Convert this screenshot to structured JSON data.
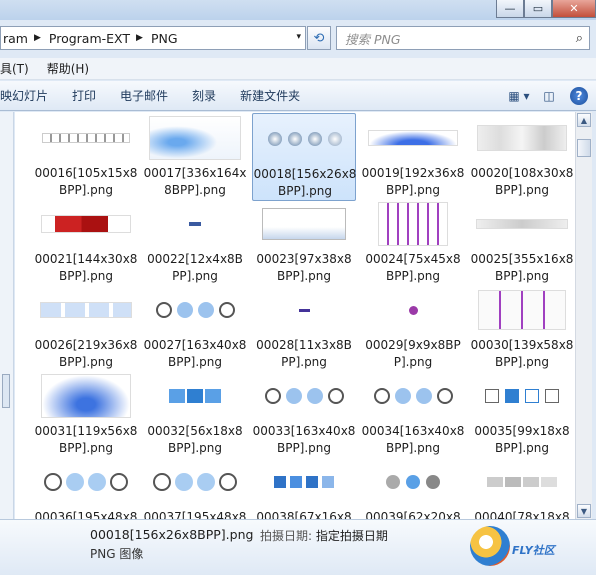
{
  "address": {
    "crumbs": [
      "ram",
      "Program-EXT",
      "PNG"
    ],
    "sep": "▶",
    "dropdown": "▾"
  },
  "search": {
    "placeholder": "搜索 PNG"
  },
  "menu": {
    "items": [
      "具(T)",
      "帮助(H)"
    ]
  },
  "toolbar": {
    "items": [
      "映幻灯片",
      "打印",
      "电子邮件",
      "刻录",
      "新建文件夹"
    ]
  },
  "files": [
    {
      "name": "00016[105x15x8BPP].png",
      "line1": "00016[105x15x8",
      "line2": "BPP].png"
    },
    {
      "name": "00017[336x164x8BPP].png",
      "line1": "00017[336x164x",
      "line2": "8BPP].png"
    },
    {
      "name": "00018[156x26x8BPP].png",
      "line1": "00018[156x26x8",
      "line2": "BPP].png",
      "selected": true
    },
    {
      "name": "00019[192x36x8BPP].png",
      "line1": "00019[192x36x8",
      "line2": "BPP].png"
    },
    {
      "name": "00020[108x30x8BPP].png",
      "line1": "00020[108x30x8",
      "line2": "BPP].png"
    },
    {
      "name": "00021[144x30x8BPP].png",
      "line1": "00021[144x30x8",
      "line2": "BPP].png"
    },
    {
      "name": "00022[12x4x8BPP].png",
      "line1": "00022[12x4x8B",
      "line2": "PP].png"
    },
    {
      "name": "00023[97x38x8BPP].png",
      "line1": "00023[97x38x8",
      "line2": "BPP].png"
    },
    {
      "name": "00024[75x45x8BPP].png",
      "line1": "00024[75x45x8",
      "line2": "BPP].png"
    },
    {
      "name": "00025[355x16x8BPP].png",
      "line1": "00025[355x16x8",
      "line2": "BPP].png"
    },
    {
      "name": "00026[219x36x8BPP].png",
      "line1": "00026[219x36x8",
      "line2": "BPP].png"
    },
    {
      "name": "00027[163x40x8BPP].png",
      "line1": "00027[163x40x8",
      "line2": "BPP].png"
    },
    {
      "name": "00028[11x3x8BPP].png",
      "line1": "00028[11x3x8B",
      "line2": "PP].png"
    },
    {
      "name": "00029[9x9x8BPP].png",
      "line1": "00029[9x9x8BP",
      "line2": "P].png"
    },
    {
      "name": "00030[139x58x8BPP].png",
      "line1": "00030[139x58x8",
      "line2": "BPP].png"
    },
    {
      "name": "00031[119x56x8BPP].png",
      "line1": "00031[119x56x8",
      "line2": "BPP].png"
    },
    {
      "name": "00032[56x18x8BPP].png",
      "line1": "00032[56x18x8",
      "line2": "BPP].png"
    },
    {
      "name": "00033[163x40x8BPP].png",
      "line1": "00033[163x40x8",
      "line2": "BPP].png"
    },
    {
      "name": "00034[163x40x8BPP].png",
      "line1": "00034[163x40x8",
      "line2": "BPP].png"
    },
    {
      "name": "00035[99x18x8BPP].png",
      "line1": "00035[99x18x8",
      "line2": "BPP].png"
    },
    {
      "name": "00036[195x48x8BPP].png",
      "line1": "00036[195x48x8",
      "line2": "BPP].png"
    },
    {
      "name": "00037[195x48x8BPP].png",
      "line1": "00037[195x48x8",
      "line2": "BPP].png"
    },
    {
      "name": "00038[67x16x8BPP].png",
      "line1": "00038[67x16x8",
      "line2": "BPP].png"
    },
    {
      "name": "00039[62x20x8BPP].png",
      "line1": "00039[62x20x8",
      "line2": "BPP].png"
    },
    {
      "name": "00040[78x18x8BPP].png",
      "line1": "00040[78x18x8",
      "line2": "BPP].png"
    }
  ],
  "status": {
    "filename": "00018[156x26x8BPP].png",
    "date_key": "拍摄日期:",
    "date_value": "指定拍摄日期",
    "type": "PNG 图像"
  },
  "watermark": {
    "text": "FLY社区"
  },
  "icons": [
    "minimize-icon",
    "maximize-icon",
    "close-icon",
    "refresh-icon",
    "search-icon",
    "views-icon",
    "preview-pane-icon",
    "help-icon"
  ]
}
